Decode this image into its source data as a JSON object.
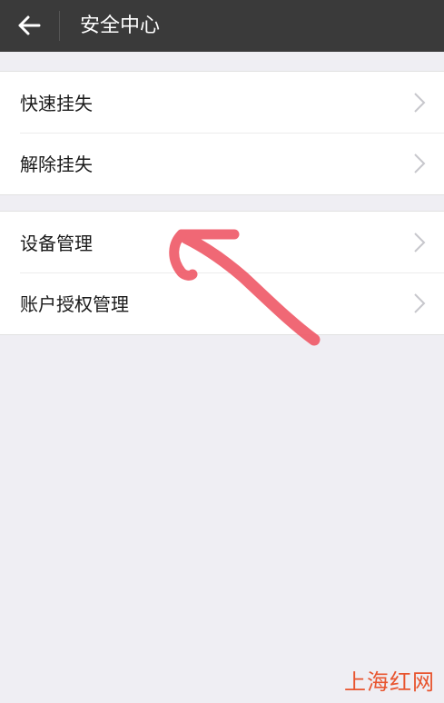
{
  "header": {
    "title": "安全中心",
    "back_icon": "arrow-left-icon"
  },
  "sections": [
    {
      "items": [
        {
          "label": "快速挂失"
        },
        {
          "label": "解除挂失"
        }
      ]
    },
    {
      "items": [
        {
          "label": "设备管理"
        },
        {
          "label": "账户授权管理"
        }
      ]
    }
  ],
  "annotation": {
    "type": "hand-drawn-arrow",
    "color": "#f0606e"
  },
  "watermark": {
    "text": "上海红网"
  },
  "colors": {
    "topbar": "#3a3a3a",
    "background": "#efeef3",
    "chevron": "#c7c7cc",
    "watermark": "#e8552f"
  }
}
